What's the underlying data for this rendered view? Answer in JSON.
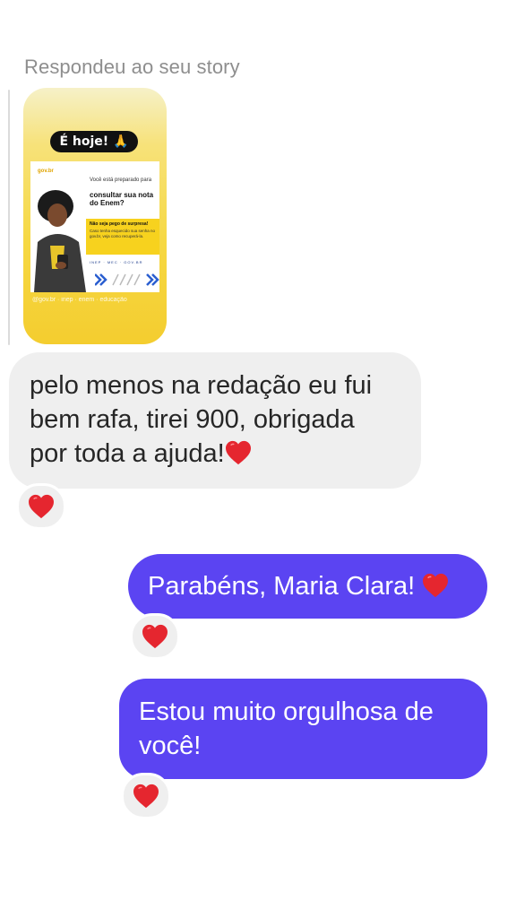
{
  "reply_header": {
    "label": "Respondeu ao seu story"
  },
  "story_preview": {
    "pill_text": "É hoje! 🙏",
    "logo_text": "gov.br",
    "intro_text": "Você está preparado para",
    "headline": "consultar sua nota do Enem?",
    "warning_title": "Não seja pego de surpresa!",
    "warning_body": "Caso tenha esquecido sua senha no gov.br, veja como recuperá-la.",
    "partner_logos": "INEP · MEC · GOV.BR",
    "caption": "@gov.br · inep · enem · educação"
  },
  "messages": [
    {
      "direction": "received",
      "text": "pelo menos na redação eu fui bem rafa, tirei 900, obrigada por toda a ajuda!",
      "emoji_icon": "red-heart-icon",
      "reaction_icon": "red-heart-icon"
    },
    {
      "direction": "sent",
      "text": "Parabéns, Maria Clara!",
      "emoji_icon": "red-heart-icon",
      "reaction_icon": "red-heart-icon"
    },
    {
      "direction": "sent",
      "text": "Estou muito orgulhosa de você!",
      "reaction_icon": "red-heart-icon"
    }
  ],
  "colors": {
    "sent_bubble": "#5b44f2",
    "received_bubble": "#efefef",
    "heart": "#e5262f",
    "meta_text": "#8e8e8e"
  }
}
